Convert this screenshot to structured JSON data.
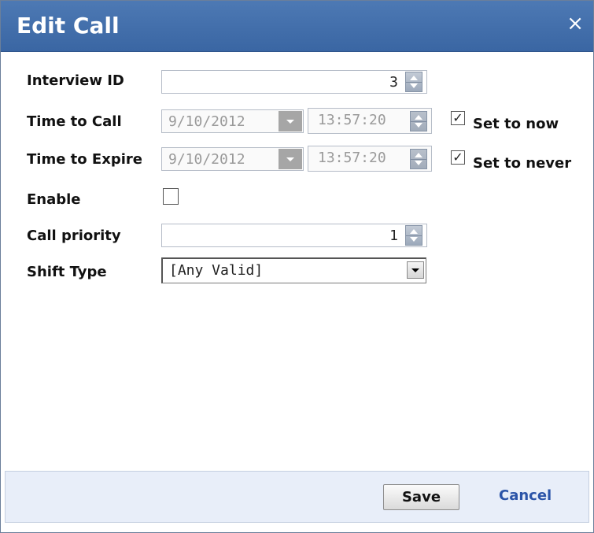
{
  "dialog": {
    "title": "Edit Call",
    "close_glyph": "×"
  },
  "fields": {
    "interview_id": {
      "label": "Interview ID",
      "value": "3"
    },
    "time_to_call": {
      "label": "Time to Call",
      "date": "9/10/2012",
      "time": "13:57:20",
      "checkbox_label": "Set to now",
      "checked": true
    },
    "time_to_expire": {
      "label": "Time to Expire",
      "date": "9/10/2012",
      "time": "13:57:20",
      "checkbox_label": "Set to never",
      "checked": true
    },
    "enable": {
      "label": "Enable",
      "checked": false
    },
    "call_priority": {
      "label": "Call priority",
      "value": "1"
    },
    "shift_type": {
      "label": "Shift Type",
      "selected": "[Any Valid]"
    }
  },
  "footer": {
    "save_label": "Save",
    "cancel_label": "Cancel"
  },
  "colors": {
    "title_bar": "#3a66a3",
    "footer_bg": "#e8eef9",
    "link": "#2b54a8"
  }
}
